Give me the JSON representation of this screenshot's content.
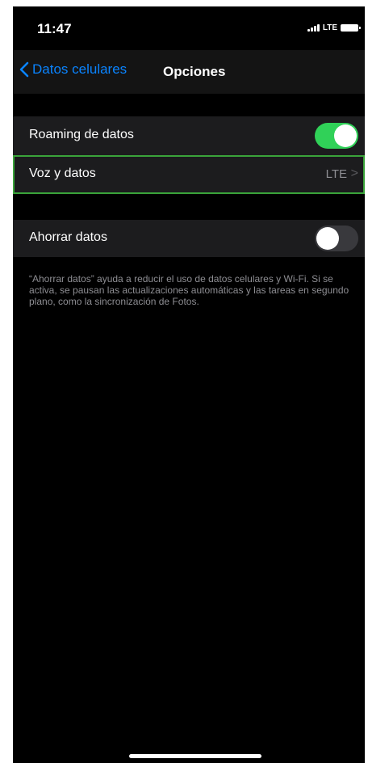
{
  "status_bar": {
    "time": "11:47",
    "network": "LTE",
    "signal_icon": "signal-bars-icon",
    "battery_icon": "battery-icon"
  },
  "nav": {
    "back_label": "Datos celulares",
    "back_icon": "chevron-left-icon",
    "title": "Opciones"
  },
  "settings": {
    "roaming": {
      "label": "Roaming de datos",
      "enabled": true
    },
    "voice_data": {
      "label": "Voz y datos",
      "value": "LTE",
      "chevron": ">"
    },
    "low_data": {
      "label": "Ahorrar datos",
      "enabled": false
    },
    "low_data_note": "“Ahorrar datos” ayuda a reducir el uso de datos celulares y Wi-Fi. Si se activa, se pausan las actualizaciones automáticas y las tareas en segundo plano, como la sincronización de Fotos."
  },
  "colors": {
    "accent_blue": "#0a84ff",
    "toggle_on": "#30d158",
    "highlight_border": "#3aa33a"
  }
}
